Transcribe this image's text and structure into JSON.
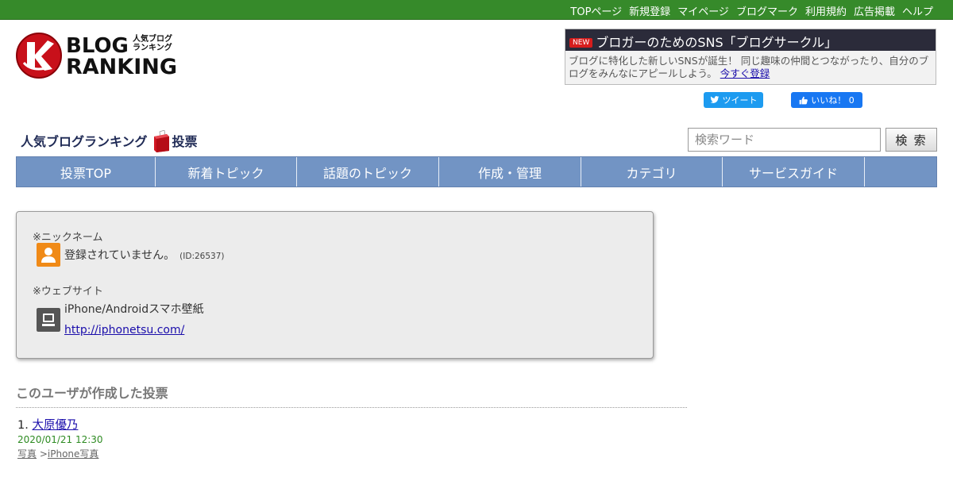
{
  "topnav": {
    "items": [
      "TOPページ",
      "新規登録",
      "マイページ",
      "ブログマーク",
      "利用規約",
      "広告掲載",
      "ヘルプ"
    ]
  },
  "logo": {
    "word1": "BLOG",
    "word2": "RANKING",
    "sub1": "人気ブログ",
    "sub2": "ランキング"
  },
  "promo": {
    "badge": "NEW",
    "title": "ブロガーのためのSNS「ブログサークル」",
    "text": "ブログに特化した新しいSNSが誕生！ 同じ趣味の仲間とつながったり、自分のブログをみんなにアピールしよう。",
    "link": "今すぐ登録"
  },
  "social": {
    "tweet": "ツイート",
    "like": "いいね！ 0"
  },
  "section": {
    "title": "人気ブログランキング",
    "vote": "投票"
  },
  "search": {
    "placeholder": "検索ワード",
    "button": "検 索"
  },
  "nav": {
    "items": [
      "投票TOP",
      "新着トピック",
      "話題のトピック",
      "作成・管理",
      "カテゴリ",
      "サービスガイド",
      ""
    ]
  },
  "profile": {
    "nickname_label": "※ニックネーム",
    "nickname": "登録されていません。",
    "id": "(ID:26537)",
    "website_label": "※ウェブサイト",
    "site_name": "iPhone/Androidスマホ壁紙",
    "site_url": "http://iphonetsu.com/"
  },
  "created": {
    "heading": "このユーザが作成した投票",
    "items": [
      {
        "number": "1.",
        "title": "大原優乃",
        "date": "2020/01/21 12:30",
        "category": "写真",
        "separator": ">",
        "subcategory": "iPhone写真"
      }
    ]
  },
  "colors": {
    "topbar": "#368a2a",
    "nav": "#7294c4",
    "promo_header": "#2b2b3a",
    "link": "#1a0dab",
    "date": "#2e8b22"
  }
}
